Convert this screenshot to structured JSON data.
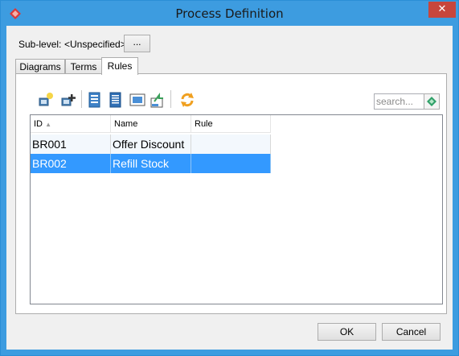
{
  "window": {
    "title": "Process Definition",
    "close_label": "✕",
    "icon": "app-diamond-icon"
  },
  "sublevel": {
    "label": "Sub-level:",
    "value": "<Unspecified>",
    "browse_label": "..."
  },
  "tabs": [
    {
      "label": "Diagrams"
    },
    {
      "label": "Terms"
    },
    {
      "label": "Rules",
      "active": true
    }
  ],
  "toolbar": {
    "icons": [
      "new-rule-icon",
      "add-rule-icon",
      "edit-icon",
      "document-icon",
      "screen-icon",
      "export-icon",
      "refresh-icon"
    ],
    "search_placeholder": "search..."
  },
  "table": {
    "columns": [
      "ID",
      "Name",
      "Rule"
    ],
    "sort_indicator": "▲",
    "rows": [
      {
        "id": "BR001",
        "name": "Offer Discount",
        "rule": ""
      },
      {
        "id": "BR002",
        "name": "Refill Stock",
        "rule": "",
        "selected": true
      }
    ]
  },
  "buttons": {
    "ok": "OK",
    "cancel": "Cancel"
  },
  "colors": {
    "titlebar": "#3d9ce0",
    "selection": "#3399ff",
    "close": "#c7463c"
  }
}
